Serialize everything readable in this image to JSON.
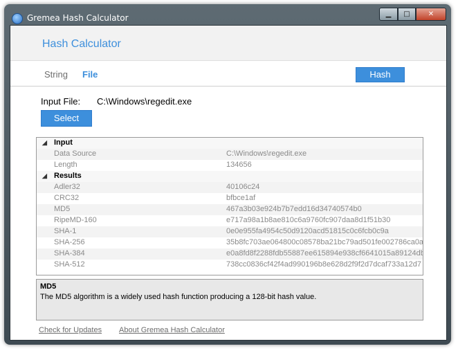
{
  "window": {
    "title": "Gremea Hash Calculator",
    "controls": {
      "minimize": "▁",
      "maximize": "□",
      "close": "✕"
    }
  },
  "header": {
    "app_title": "Hash Calculator"
  },
  "tabs": [
    {
      "label": "String",
      "selected": false
    },
    {
      "label": "File",
      "selected": true
    }
  ],
  "hash_button": "Hash",
  "file": {
    "label": "Input File:",
    "value": "C:\\Windows\\regedit.exe",
    "select_button": "Select"
  },
  "grid": {
    "input_category": "Input",
    "input_rows": [
      {
        "name": "Data Source",
        "value": "C:\\Windows\\regedit.exe"
      },
      {
        "name": "Length",
        "value": "134656"
      }
    ],
    "results_category": "Results",
    "result_rows": [
      {
        "name": "Adler32",
        "value": "40106c24"
      },
      {
        "name": "CRC32",
        "value": "bfbce1af"
      },
      {
        "name": "MD5",
        "value": "467a3b03e924b7b7edd16d34740574b0"
      },
      {
        "name": "RipeMD-160",
        "value": "e717a98a1b8ae810c6a9760fc907daa8d1f51b30"
      },
      {
        "name": "SHA-1",
        "value": "0e0e955fa4954c50d9120acd51815c0c6fcb0c9a"
      },
      {
        "name": "SHA-256",
        "value": "35b8fc703ae064800c08578ba21bc79ad501fe002786ca0a"
      },
      {
        "name": "SHA-384",
        "value": "e0a8fd8f2288fdb55887ee615894e938cf6641015a89124db"
      },
      {
        "name": "SHA-512",
        "value": "738cc0836cf42f4ad990196b8e628d2f9f2d7dcaf733a12d7"
      }
    ],
    "selected_row": "MD5"
  },
  "description": {
    "title": "MD5",
    "text": "The MD5 algorithm is a widely used hash function producing a 128-bit hash value."
  },
  "footer": {
    "check_updates": "Check for Updates",
    "about": "About Gremea Hash Calculator"
  },
  "colors": {
    "accent": "#3d8fdc",
    "muted_text": "#8a8a8a"
  }
}
